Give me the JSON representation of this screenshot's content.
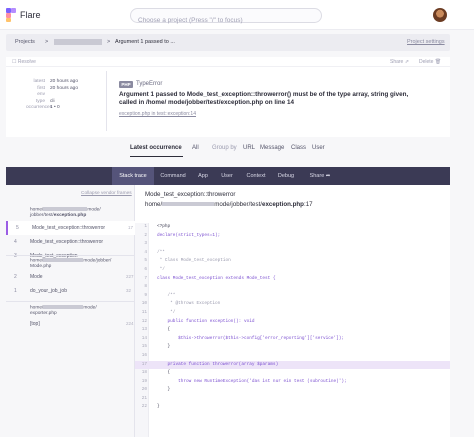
{
  "app": {
    "name": "Flare"
  },
  "search": {
    "placeholder": "Choose a project (Press \"/\" to focus)"
  },
  "breadcrumb": {
    "projects": "Projects",
    "sep": ">",
    "current": "Argument 1 passed to ...",
    "settings": "Project settings"
  },
  "error_card": {
    "resolve": "Resolve",
    "share": "Share",
    "delete": "Delete",
    "meta": [
      {
        "key": "latest",
        "value": "20 hours ago"
      },
      {
        "key": "first",
        "value": "20 hours ago"
      },
      {
        "key": "env",
        "value": ""
      },
      {
        "key": "type",
        "value": "cli"
      },
      {
        "key": "occurrences",
        "value": "1 • 0"
      }
    ],
    "badge": "PHP",
    "exception_class": "TypeError",
    "message": "Argument 1 passed to Mode_test_exception::throwerror() must be of the type array, string given, called in /home/          mode/jobber/test/exception.php on line 14",
    "exception_line": "exception.php in test::exception:14"
  },
  "occurrence_tabs": {
    "latest": "Latest occurrence",
    "all": "All",
    "group_by": "Group by",
    "url": "URL",
    "message": "Message",
    "class": "Class",
    "user": "User"
  },
  "detail_tabs": [
    "Stack trace",
    "Command",
    "App",
    "User",
    "Context",
    "Debug",
    "Share"
  ],
  "stack": {
    "collapse": "Collapse vendor frames",
    "groups": [
      {
        "path1": "home/",
        "path1b": "mode/",
        "path2": "jobber/test/",
        "path2b": "exception.php",
        "frames": [
          {
            "num": "5",
            "name": "Mode_test_exception::throwerror",
            "line": "17",
            "selected": true
          },
          {
            "num": "4",
            "name": "Mode_test_exception::throwerror",
            "line": "",
            "selected": false
          },
          {
            "num": "3",
            "name": "Mode_test_exception",
            "line": "",
            "selected": false
          }
        ]
      },
      {
        "path1": "home/",
        "path1b": "mode/jobber/",
        "path2": "Mode.php",
        "frames": [
          {
            "num": "2",
            "name": "Mode",
            "line": "227",
            "selected": false
          },
          {
            "num": "1",
            "name": "do_your_job_job",
            "line": "32",
            "selected": false
          }
        ]
      },
      {
        "path1": "home/",
        "path1b": "mode/",
        "path2": "exporter.php",
        "frames": [
          {
            "num": "",
            "name": "[top]",
            "line": "224",
            "selected": false
          }
        ]
      }
    ]
  },
  "code_panel": {
    "class_method": "Mode_test_exception::throwerror",
    "file_prefix": "home/",
    "file_suffix": "mode/jobber/test/",
    "file_name": "exception.php",
    "file_line": ":17",
    "lines": [
      {
        "n": "1",
        "t": "<?php",
        "hl": false
      },
      {
        "n": "2",
        "t": "declare(strict_types=1);",
        "hl": false
      },
      {
        "n": "3",
        "t": "",
        "hl": false
      },
      {
        "n": "4",
        "t": "/**",
        "hl": false
      },
      {
        "n": "5",
        "t": " * Class Mode_test_exception",
        "hl": false
      },
      {
        "n": "6",
        "t": " */",
        "hl": false
      },
      {
        "n": "7",
        "t": "class Mode_test_exception extends Mode_test {",
        "hl": false
      },
      {
        "n": "8",
        "t": "",
        "hl": false
      },
      {
        "n": "9",
        "t": "    /**",
        "hl": false
      },
      {
        "n": "10",
        "t": "     * @throws Exception",
        "hl": false
      },
      {
        "n": "11",
        "t": "     */",
        "hl": false
      },
      {
        "n": "12",
        "t": "    public function exception(): void",
        "hl": false
      },
      {
        "n": "13",
        "t": "    {",
        "hl": false
      },
      {
        "n": "14",
        "t": "        $this->throwerror($this->config['error_reporting']['service']);",
        "hl": false
      },
      {
        "n": "15",
        "t": "    }",
        "hl": false
      },
      {
        "n": "16",
        "t": "",
        "hl": false
      },
      {
        "n": "17",
        "t": "    private function throwerror(array $params)",
        "hl": true
      },
      {
        "n": "18",
        "t": "    {",
        "hl": false
      },
      {
        "n": "19",
        "t": "        throw new RuntimeException('das ist nur ein test (subroutine)');",
        "hl": false
      },
      {
        "n": "20",
        "t": "    }",
        "hl": false
      },
      {
        "n": "21",
        "t": "",
        "hl": false
      },
      {
        "n": "22",
        "t": "}",
        "hl": false
      }
    ]
  },
  "colors": {
    "accent": "#9b5de5",
    "dark_bar": "#3b3a55",
    "highlight": "#ede4f8"
  }
}
